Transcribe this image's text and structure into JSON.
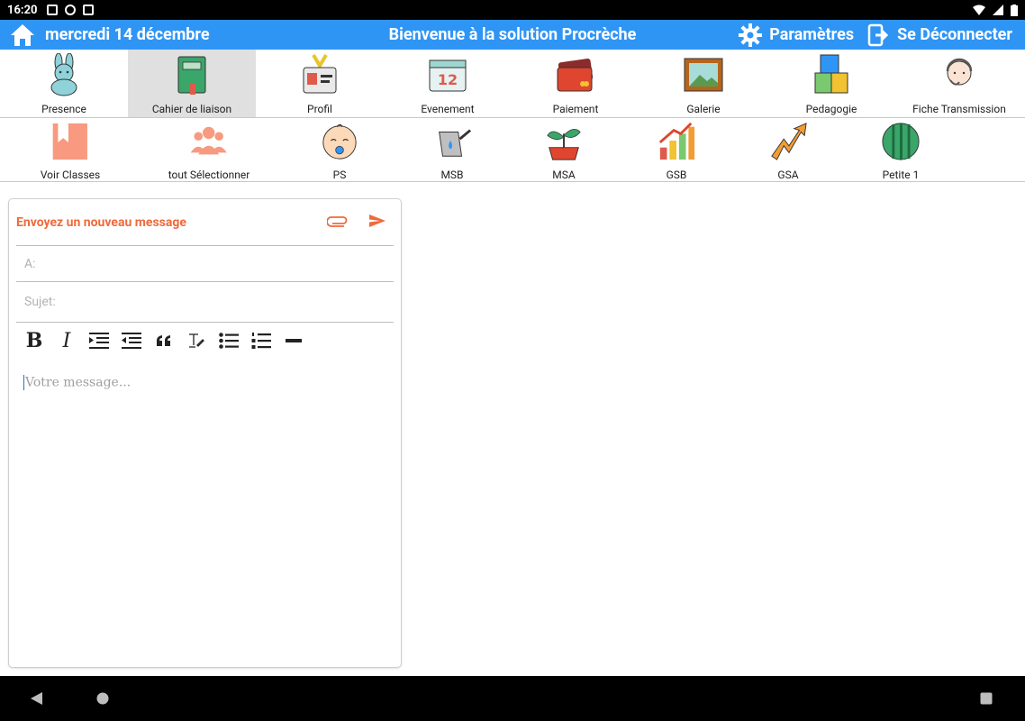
{
  "status": {
    "time": "16:20"
  },
  "header": {
    "date": "mercredi 14 décembre",
    "title": "Bienvenue à la solution Procrèche",
    "settings_label": "Paramètres",
    "logout_label": "Se Déconnecter",
    "color": "#2f95f5"
  },
  "nav": [
    {
      "label": "Presence",
      "icon": "bunny-icon"
    },
    {
      "label": "Cahier de liaison",
      "icon": "notebook-icon",
      "active": true
    },
    {
      "label": "Profil",
      "icon": "badge-icon"
    },
    {
      "label": "Evenement",
      "icon": "calendar-icon"
    },
    {
      "label": "Paiement",
      "icon": "card-icon"
    },
    {
      "label": "Galerie",
      "icon": "picture-icon"
    },
    {
      "label": "Pedagogie",
      "icon": "blocks-icon"
    },
    {
      "label": "Fiche Transmission",
      "icon": "baby-headset-icon"
    }
  ],
  "classes": [
    {
      "label": "Voir Classes",
      "icon": "bookmark-icon"
    },
    {
      "label": "tout Sélectionner",
      "icon": "group-icon"
    },
    {
      "label": "PS",
      "icon": "baby-face-icon"
    },
    {
      "label": "MSB",
      "icon": "watering-can-icon"
    },
    {
      "label": "MSA",
      "icon": "sprout-icon"
    },
    {
      "label": "GSB",
      "icon": "growth-chart-icon"
    },
    {
      "label": "GSA",
      "icon": "arrow-zigzag-icon"
    },
    {
      "label": "Petite 1",
      "icon": "striped-circle-icon"
    }
  ],
  "composer": {
    "heading": "Envoyez un nouveau message",
    "to_placeholder": "A:",
    "subject_placeholder": "Sujet:",
    "body_placeholder": "Votre message...",
    "accent": "#ee6a3c",
    "toolbar": {
      "bold": "B",
      "italic": "I"
    }
  }
}
